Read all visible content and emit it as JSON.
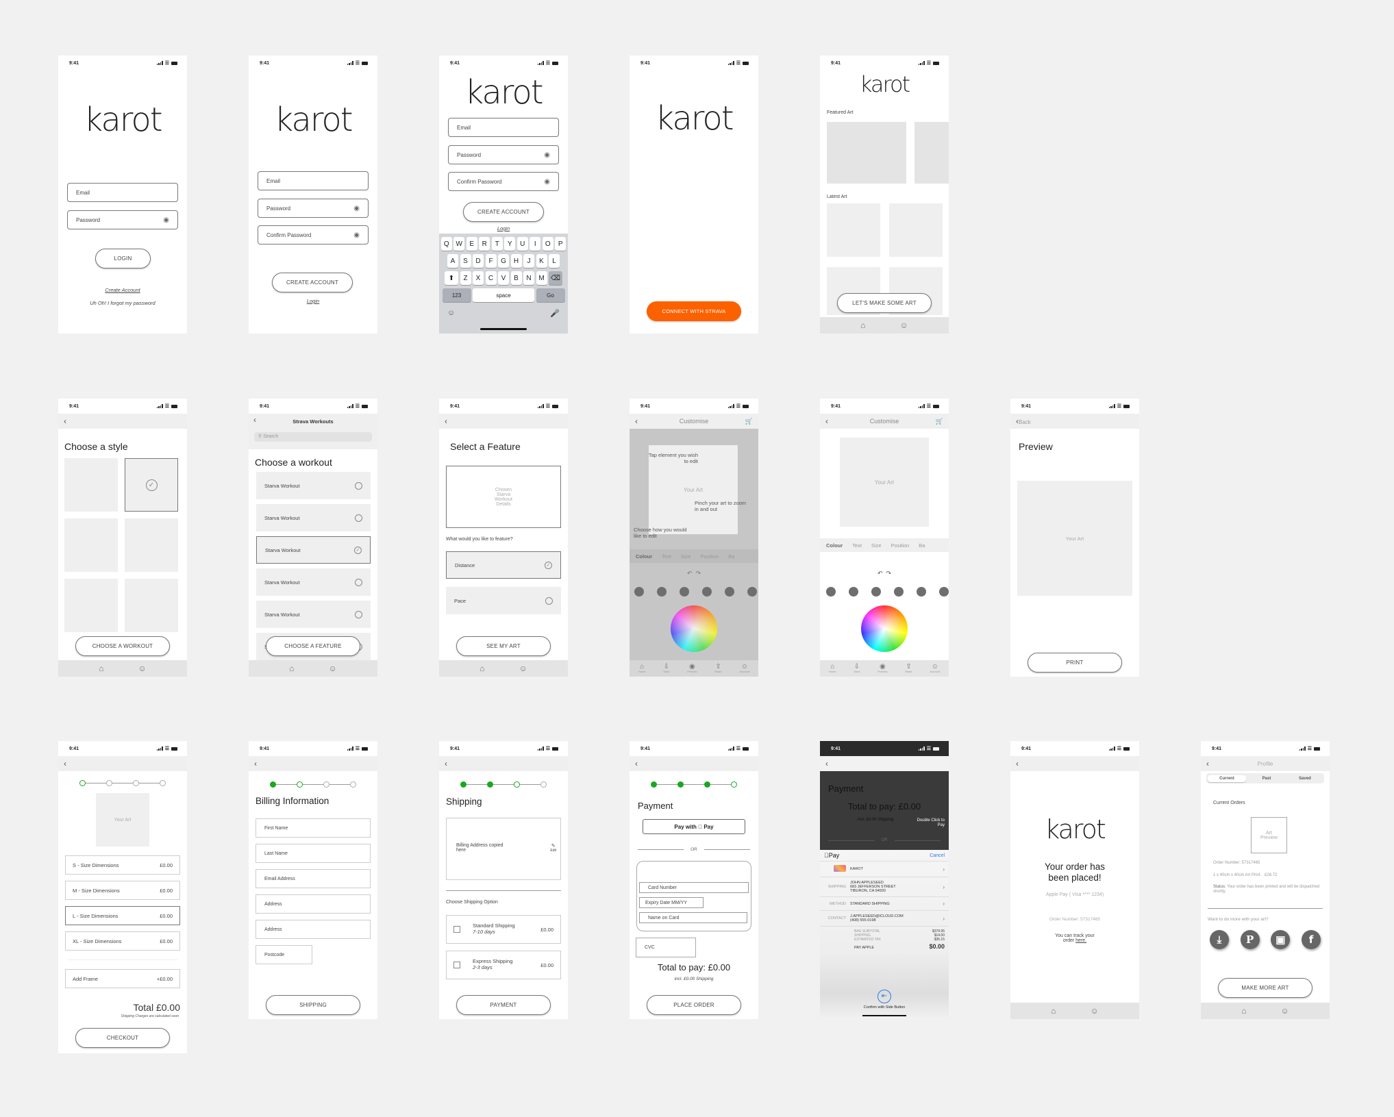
{
  "status_time": "9:41",
  "logo": "karot",
  "screens": {
    "login": {
      "email_placeholder": "Email",
      "password_placeholder": "Password",
      "login_button": "LOGIN",
      "create_account_link": "Create Account",
      "forgot_link": "Uh Oh! I forgot my password"
    },
    "signup": {
      "email_placeholder": "Email",
      "password_placeholder": "Password",
      "confirm_placeholder": "Confirm Password",
      "create_button": "CREATE ACCOUNT",
      "login_link": "Login"
    },
    "signup_keyboard": {
      "email_placeholder": "Email",
      "password_placeholder": "Password",
      "confirm_placeholder": "Confirm Password",
      "create_button": "CREATE ACCOUNT",
      "login_link": "Login",
      "keyboard": {
        "row1": [
          "Q",
          "W",
          "E",
          "R",
          "T",
          "Y",
          "U",
          "I",
          "O",
          "P"
        ],
        "row2": [
          "A",
          "S",
          "D",
          "F",
          "G",
          "H",
          "J",
          "K",
          "L"
        ],
        "row3": [
          "Z",
          "X",
          "C",
          "V",
          "B",
          "N",
          "M"
        ],
        "numbers_key": "123",
        "space_key": "space",
        "go_key": "Go"
      }
    },
    "connect": {
      "strava_button": "CONNECT WITH STRAVA",
      "strava_color": "#fc6100"
    },
    "home": {
      "featured_label": "Featured Art",
      "latest_label": "Latest Art",
      "cta_button": "LET'S MAKE SOME ART"
    },
    "choose_style": {
      "title": "Choose a style",
      "cta_button": "CHOOSE A WORKOUT"
    },
    "choose_workout": {
      "nav_title": "Strava Workouts",
      "search_placeholder": "Search",
      "title": "Choose a workout",
      "items": [
        {
          "label": "Starva Workout",
          "selected": false
        },
        {
          "label": "Starva Workout",
          "selected": false
        },
        {
          "label": "Starva Workout",
          "selected": true
        },
        {
          "label": "Starva Workout",
          "selected": false
        },
        {
          "label": "Starva Workout",
          "selected": false
        },
        {
          "label": "Starva Workout",
          "selected": false
        }
      ],
      "cta_button": "CHOOSE A FEATURE"
    },
    "select_feature": {
      "title": "Select a Feature",
      "details_placeholder": "Chosen Starva Workout Details",
      "question": "What would you like to feature?",
      "options": [
        {
          "label": "Distance",
          "selected": true
        },
        {
          "label": "Pace",
          "selected": false
        }
      ],
      "cta_button": "SEE MY ART"
    },
    "customise_tutorial": {
      "nav_title": "Customise",
      "art_label": "Your Art",
      "hint_tap": "Tap element you wish to edit",
      "hint_pinch": "Pinch your art to zoom in and out",
      "hint_choose": "Choose how you would like to edit"
    },
    "customise": {
      "nav_title": "Customise",
      "art_label": "Your Art",
      "tabs": [
        "Colour",
        "Text",
        "Size",
        "Position",
        "Ba"
      ],
      "active_tab": "Colour",
      "bottom_tabs": [
        "Home",
        "Save",
        "Preview",
        "Share",
        "Account"
      ]
    },
    "preview": {
      "back_label": "Back",
      "title": "Preview",
      "art_label": "Your Art",
      "cta_button": "PRINT"
    },
    "size": {
      "art_label": "Your Art",
      "options": [
        {
          "label": "S - Size Dimensions",
          "price": "£0.00",
          "selected": false
        },
        {
          "label": "M - Size Dimensions",
          "price": "£0.00",
          "selected": false
        },
        {
          "label": "L - Size Dimensions",
          "price": "£0.00",
          "selected": true
        },
        {
          "label": "XL - Size Dimensions",
          "price": "£0.00",
          "selected": false
        }
      ],
      "frame_label": "Add Frame",
      "frame_price": "+£0.00",
      "total": "Total £0.00",
      "shipping_note": "Shipping Charges are calculated soon",
      "cta_button": "CHECKOUT"
    },
    "billing": {
      "title": "Billing Information",
      "fields": [
        "First Name",
        "Last Name",
        "Email Address",
        "Address",
        "Address"
      ],
      "postcode": "Postcode",
      "cta_button": "SHIPPING"
    },
    "shipping": {
      "title": "Shipping",
      "address_placeholder": "Billing Address copied here",
      "edit_label": "Edit",
      "option_heading": "Choose Shipping Option",
      "options": [
        {
          "label": "Standard Shipping",
          "time": "7-10 days",
          "price": "£0.00"
        },
        {
          "label": "Express Shipping",
          "time": "2-3 days",
          "price": "£0.00"
        }
      ],
      "cta_button": "PAYMENT"
    },
    "payment": {
      "title": "Payment",
      "applepay_button": "Pay with  Pay",
      "or_label": "OR",
      "card_number": "Card Number",
      "expiry": "Expiry Date MM/YY",
      "name_on_card": "Name on Card",
      "cvc": "CVC",
      "total": "Total to pay: £0.00",
      "shipping_note": "incl. £0.00 Shipping",
      "cta_button": "PLACE ORDER"
    },
    "applepay_sheet": {
      "title": "Payment",
      "total": "Total to pay: £0.00",
      "shipping_note": "incl. £0.00 Shipping",
      "double_click": "Double Click to Pay",
      "or_label": "OR",
      "sheet_title": "Pay",
      "cancel": "Cancel",
      "merchant": "KAROT",
      "shipping_key": "SHIPPING",
      "shipping_value": [
        "JOHN APPLESEED",
        "683 JEFFERSON STREET",
        "TIBURON, CA 94920"
      ],
      "method_key": "METHOD",
      "method_value": "STANDARD SHIPPING",
      "contact_key": "CONTACT",
      "contact_value": [
        "J.APPLESEED@ICLOUD.COM",
        "(408) 555-0198"
      ],
      "lines": [
        {
          "label": "BAG SUBTOTAL",
          "value": "$379.95"
        },
        {
          "label": "SHIPPING",
          "value": "$14.00"
        },
        {
          "label": "ESTIMATED TAX",
          "value": "$35.15"
        }
      ],
      "pay_label": "PAY APPLE",
      "pay_value": "$0.00",
      "confirm": "Confirm with Side Button"
    },
    "confirmation": {
      "heading": "Your order has been placed!",
      "method": "Apple Pay ( Visa **** 1234)",
      "order_number": "Order Number: 57317465",
      "track_text": "You can track your order",
      "track_link": "here."
    },
    "profile": {
      "nav_title": "Profile",
      "segments": [
        "Current",
        "Past",
        "Saved"
      ],
      "active_segment": "Current",
      "section_title": "Current Orders",
      "art_preview": "Art Preview",
      "order_number": "Order Number: 57317465",
      "item": "1 x 40cm x 40cm Art Print.",
      "item_price": "£26.72",
      "status_label": "Status:",
      "status_text": "Your order has been printed and will be dispatched shortly.",
      "more_prompt": "Want to do more with your art?",
      "cta_button": "MAKE MORE ART"
    }
  },
  "accent_green": "#18a81e"
}
